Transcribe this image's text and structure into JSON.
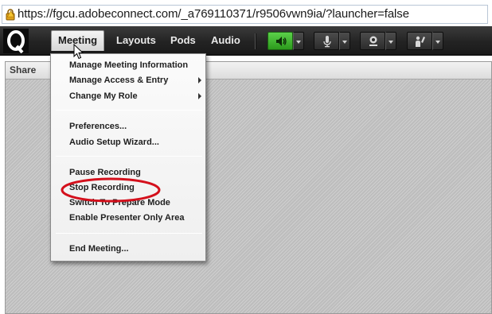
{
  "browser": {
    "url": "https://fgcu.adobeconnect.com/_a769110371/r9506vwn9ia/?launcher=false"
  },
  "menubar": {
    "tabs": [
      {
        "label": "Meeting",
        "active": true
      },
      {
        "label": "Layouts",
        "active": false
      },
      {
        "label": "Pods",
        "active": false
      },
      {
        "label": "Audio",
        "active": false
      }
    ],
    "tools": [
      "speaker-icon",
      "microphone-icon",
      "webcam-icon",
      "raise-hand-icon"
    ]
  },
  "share_pod": {
    "title": "Share"
  },
  "meeting_menu": {
    "items": [
      {
        "label": "Manage Meeting Information",
        "submenu": false
      },
      {
        "label": "Manage Access & Entry",
        "submenu": true
      },
      {
        "label": "Change My Role",
        "submenu": true
      },
      {
        "label": "Preferences...",
        "submenu": false
      },
      {
        "label": "Audio Setup Wizard...",
        "submenu": false
      },
      {
        "label": "Pause Recording",
        "submenu": false
      },
      {
        "label": "Stop Recording",
        "submenu": false,
        "highlighted": true
      },
      {
        "label": "Switch To Prepare Mode",
        "submenu": false
      },
      {
        "label": "Enable Presenter Only Area",
        "submenu": false
      },
      {
        "label": "End Meeting...",
        "submenu": false
      }
    ]
  },
  "colors": {
    "menubar": "#232323",
    "speaker_button": "#2c9a1c",
    "annotation": "#d4101c"
  }
}
